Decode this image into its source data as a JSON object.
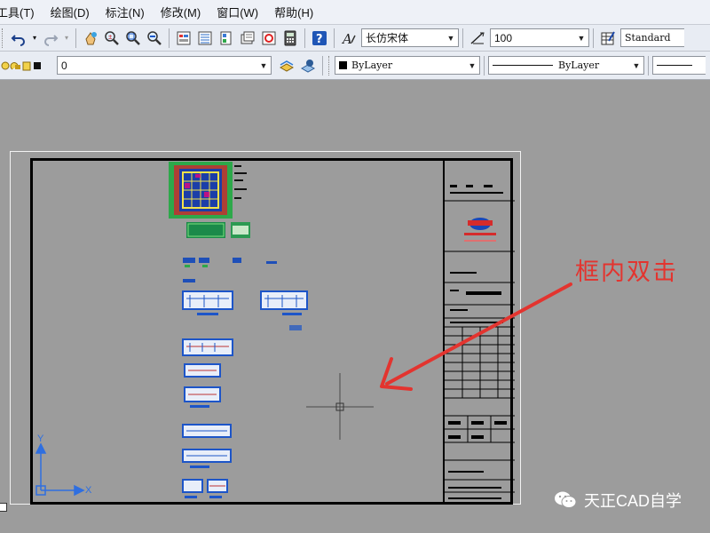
{
  "menu": {
    "items": [
      "工具(T)",
      "绘图(D)",
      "标注(N)",
      "修改(M)",
      "窗口(W)",
      "帮助(H)"
    ]
  },
  "toolbar1": {
    "font_style": "长仿宋体",
    "text_height": "100",
    "text_style": "Standard"
  },
  "toolbar2": {
    "layer": "0",
    "color": "ByLayer",
    "linetype": "ByLayer"
  },
  "annotation": {
    "label": "框内双击",
    "color": "#e3342f"
  },
  "watermark": {
    "text": "天正CAD自学"
  },
  "ucs": {
    "x_label": "X",
    "y_label": "Y",
    "color": "#2f6fe0"
  },
  "colors": {
    "canvas": "#9c9c9c",
    "toolbar": "#e8ecf3",
    "annotation_red": "#e3342f"
  }
}
